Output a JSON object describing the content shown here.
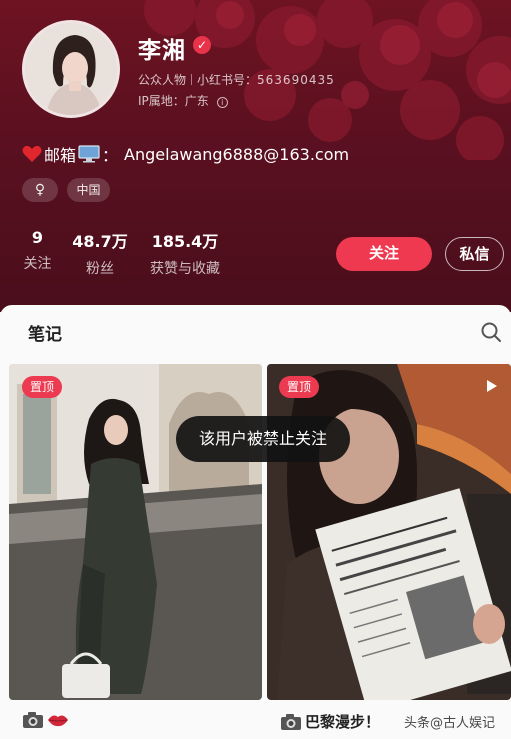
{
  "profile": {
    "name": "李湘",
    "category": "公众人物",
    "redbook_id_label": "小红书号：",
    "redbook_id": "563690435",
    "ip_location": "IP属地：广东",
    "bio_email_label": "邮箱",
    "bio_colon": "：",
    "bio_email": "Angelawang6888@163.com",
    "tags": {
      "gender": "♀",
      "region": "中国"
    }
  },
  "stats": [
    {
      "value": "9",
      "label": "关注"
    },
    {
      "value": "48.7万",
      "label": "粉丝"
    },
    {
      "value": "185.4万",
      "label": "获赞与收藏"
    }
  ],
  "actions": {
    "follow_label": "关注",
    "message_label": "私信"
  },
  "notes_tab": {
    "label": "笔记"
  },
  "cards": [
    {
      "badge": "置顶",
      "caption_icons": [
        "camera-icon",
        "lips-icon"
      ]
    },
    {
      "badge": "置顶",
      "caption": "巴黎漫步！",
      "has_video": true
    }
  ],
  "toast": "该用户被禁止关注",
  "watermark": "头条@古人娱记",
  "colors": {
    "accent": "#ee3950",
    "header_bg": "#5a1020"
  }
}
